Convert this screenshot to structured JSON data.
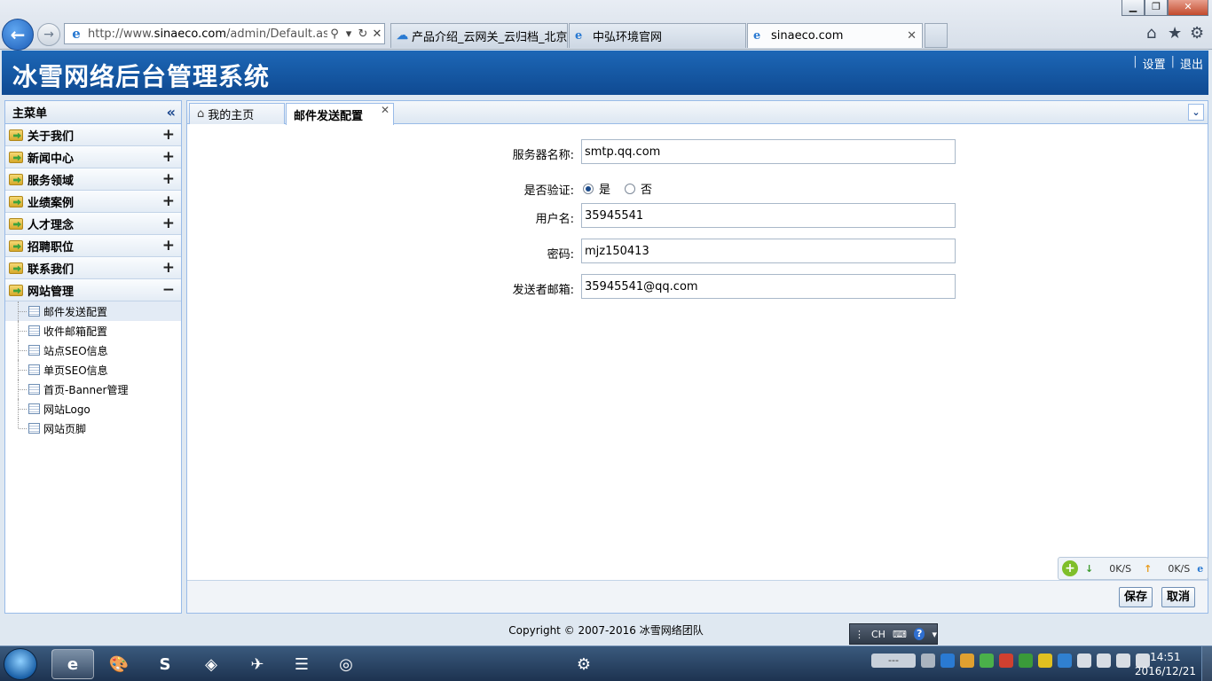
{
  "browser": {
    "url_prefix": "http://www.",
    "url_domain": "sinaeco.com",
    "url_path": "/admin/Default.aspx#N",
    "tabs": [
      {
        "label": "产品介绍_云网关_云归档_北京..."
      },
      {
        "label": "中弘环境官网"
      },
      {
        "label": "sinaeco.com"
      }
    ]
  },
  "header": {
    "title": "冰雪网络后台管理系统",
    "settings_label": "设置",
    "logout_label": "退出"
  },
  "sidebar": {
    "title": "主菜单",
    "menus": [
      {
        "label": "关于我们",
        "toggle": "+"
      },
      {
        "label": "新闻中心",
        "toggle": "+"
      },
      {
        "label": "服务领域",
        "toggle": "+"
      },
      {
        "label": "业绩案例",
        "toggle": "+"
      },
      {
        "label": "人才理念",
        "toggle": "+"
      },
      {
        "label": "招聘职位",
        "toggle": "+"
      },
      {
        "label": "联系我们",
        "toggle": "+"
      },
      {
        "label": "网站管理",
        "toggle": "−"
      }
    ],
    "sub_items": [
      {
        "label": "邮件发送配置"
      },
      {
        "label": "收件邮箱配置"
      },
      {
        "label": "站点SEO信息"
      },
      {
        "label": "单页SEO信息"
      },
      {
        "label": "首页-Banner管理"
      },
      {
        "label": "网站Logo"
      },
      {
        "label": "网站页脚"
      }
    ]
  },
  "main": {
    "tabs": [
      {
        "label": "我的主页"
      },
      {
        "label": "邮件发送配置"
      }
    ],
    "form": {
      "server_label": "服务器名称:",
      "server_value": "smtp.qq.com",
      "verify_label": "是否验证:",
      "verify_yes": "是",
      "verify_no": "否",
      "username_label": "用户名:",
      "username_value": "35945541",
      "password_label": "密码:",
      "password_value": "mjz150413",
      "sender_label": "发送者邮箱:",
      "sender_value": "35945541@qq.com"
    },
    "save_label": "保存",
    "cancel_label": "取消"
  },
  "netspeed": {
    "down": "0K/S",
    "up": "0K/S"
  },
  "footer": {
    "copyright": "Copyright © 2007-2016 冰雪网络团队"
  },
  "langbar": {
    "lang": "CH"
  },
  "taskbar": {
    "time": "14:51",
    "date": "2016/12/21",
    "tray_text": "---"
  }
}
